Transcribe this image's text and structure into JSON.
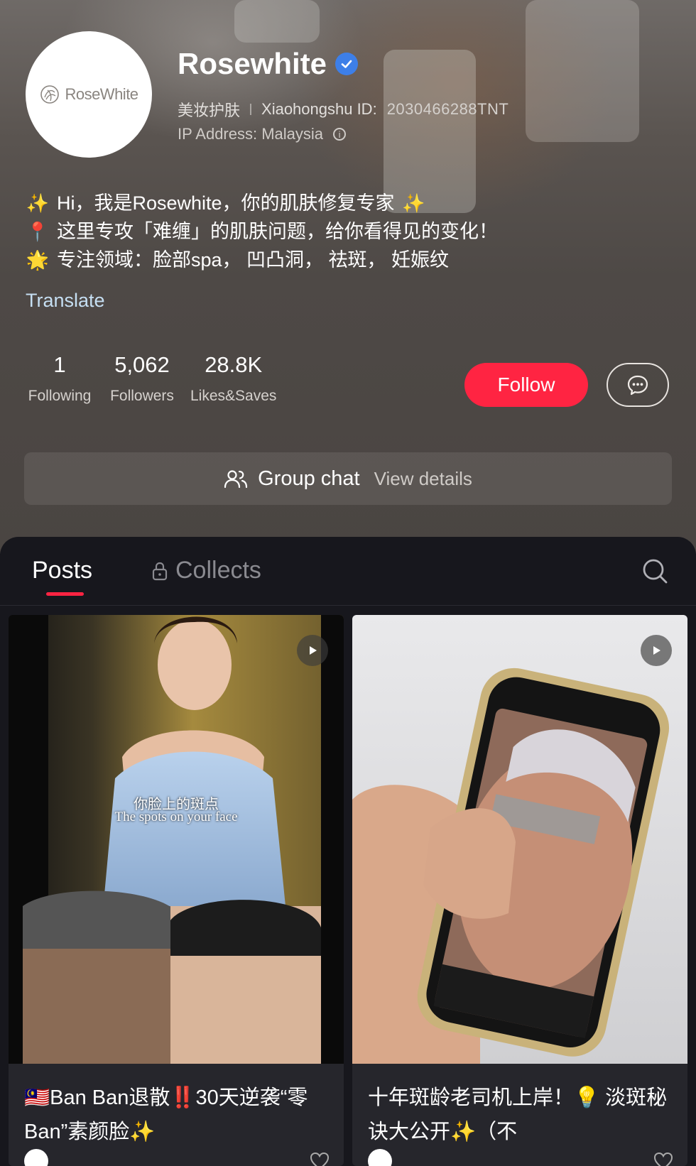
{
  "profile": {
    "avatar_logo_text": "RoseWhite",
    "name": "Rosewhite",
    "category": "美妆护肤",
    "id_label": "Xiaohongshu ID:",
    "id_value": "2030466288TNT",
    "ip_address": "IP Address: Malaysia",
    "bio": [
      {
        "icon": "sparkles-icon",
        "glyph": "✨",
        "text": "Hi，我是Rosewhite，你的肌肤修复专家",
        "trailing_glyph": "✨"
      },
      {
        "icon": "pin-icon",
        "glyph": "📍",
        "text": "这里专攻「难缠」的肌肤问题，给你看得见的变化！",
        "trailing_glyph": ""
      },
      {
        "icon": "star-icon",
        "glyph": "🌟",
        "text": "专注领域：脸部spa， 凹凸洞， 祛斑， 妊娠纹",
        "trailing_glyph": ""
      }
    ],
    "translate_label": "Translate"
  },
  "stats": [
    {
      "value": "1",
      "label": "Following"
    },
    {
      "value": "5,062",
      "label": "Followers"
    },
    {
      "value": "28.8K",
      "label": "Likes&Saves"
    }
  ],
  "actions": {
    "follow_label": "Follow"
  },
  "group_chat": {
    "title": "Group chat",
    "subtitle": "View details"
  },
  "tabs": {
    "posts": "Posts",
    "collects": "Collects"
  },
  "posts": [
    {
      "title": "🇲🇾Ban Ban退散‼️30天逆袭“零Ban”素颜脸✨",
      "video_caption_zh": "你脸上的斑点",
      "video_caption_en": "The spots on your face"
    },
    {
      "title": "十年斑龄老司机上岸！💡 淡斑秘诀大公开✨（不"
    }
  ],
  "colors": {
    "accent": "#ff2442",
    "link": "#c6dff3",
    "verified": "#3d7fe8"
  }
}
